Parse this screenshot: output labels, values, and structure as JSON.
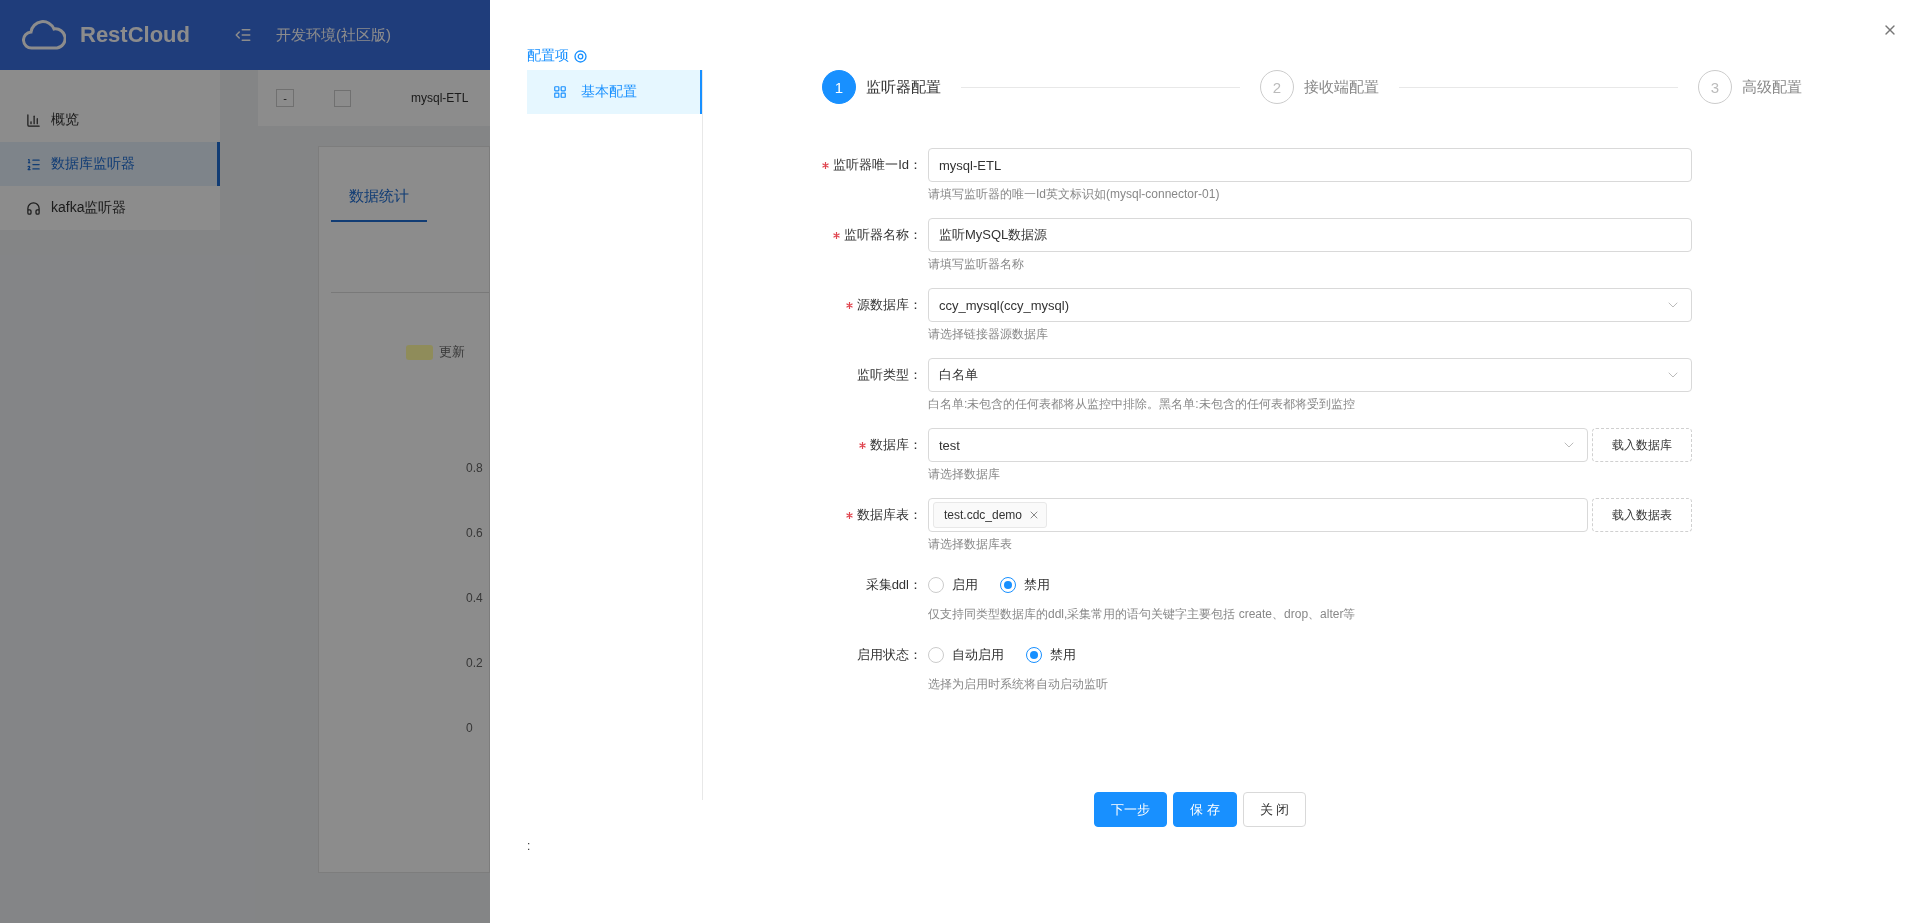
{
  "background": {
    "logo": "RestCloud",
    "environment": "开发环境(社区版)",
    "sidebar": [
      {
        "label": "概览",
        "selected": false
      },
      {
        "label": "数据库监听器",
        "selected": true
      },
      {
        "label": "kafka监听器",
        "selected": false
      }
    ],
    "table_row": {
      "expand_symbol": "-",
      "checked": false,
      "cell": "mysql-ETL"
    },
    "tab": {
      "label": "数据统计",
      "selected": true
    },
    "legend": {
      "label": "更新",
      "color": "#8f8c5a"
    },
    "y_ticks": [
      "0.8",
      "0.6",
      "0.4",
      "0.2",
      "0"
    ]
  },
  "drawer": {
    "section_title": "配置项",
    "menu": [
      {
        "label": "基本配置",
        "selected": true
      }
    ],
    "steps": [
      {
        "number": "1",
        "label": "监听器配置",
        "selected": true
      },
      {
        "number": "2",
        "label": "接收端配置",
        "selected": false
      },
      {
        "number": "3",
        "label": "高级配置",
        "selected": false
      }
    ],
    "fields": [
      {
        "kind": "input",
        "label": "监听器唯一Id：",
        "required": true,
        "value": "mysql-ETL",
        "help": "请填写监听器的唯一Id英文标识如(mysql-connector-01)"
      },
      {
        "kind": "input",
        "label": "监听器名称：",
        "required": true,
        "value": "监听MySQL数据源",
        "help": "请填写监听器名称"
      },
      {
        "kind": "select",
        "label": "源数据库：",
        "required": true,
        "value": "ccy_mysql(ccy_mysql)",
        "help": "请选择链接器源数据库"
      },
      {
        "kind": "select",
        "label": "监听类型：",
        "required": false,
        "value": "白名单",
        "help": "白名单:未包含的任何表都将从监控中排除。黑名单:未包含的任何表都将受到监控"
      },
      {
        "kind": "select",
        "label": "数据库：",
        "required": true,
        "value": "test",
        "action": "载入数据库",
        "help": "请选择数据库"
      },
      {
        "kind": "tags",
        "label": "数据库表：",
        "required": true,
        "tags": [
          "test.cdc_demo"
        ],
        "action": "载入数据表",
        "help": "请选择数据库表"
      },
      {
        "kind": "radio",
        "label": "采集ddl：",
        "required": false,
        "options": [
          {
            "label": "启用",
            "selected": false
          },
          {
            "label": "禁用",
            "selected": true
          }
        ],
        "help": "仅支持同类型数据库的ddl,采集常用的语句关键字主要包括 create、drop、alter等"
      },
      {
        "kind": "radio",
        "label": "启用状态：",
        "required": false,
        "options": [
          {
            "label": "自动启用",
            "selected": false
          },
          {
            "label": "禁用",
            "selected": true
          }
        ],
        "help": "选择为启用时系统将自动启动监听"
      }
    ],
    "buttons": [
      {
        "label": "下一步",
        "kind": "primary"
      },
      {
        "label": "保 存",
        "kind": "primary"
      },
      {
        "label": "关 闭",
        "kind": "default"
      }
    ],
    "footer_mark": ":"
  }
}
